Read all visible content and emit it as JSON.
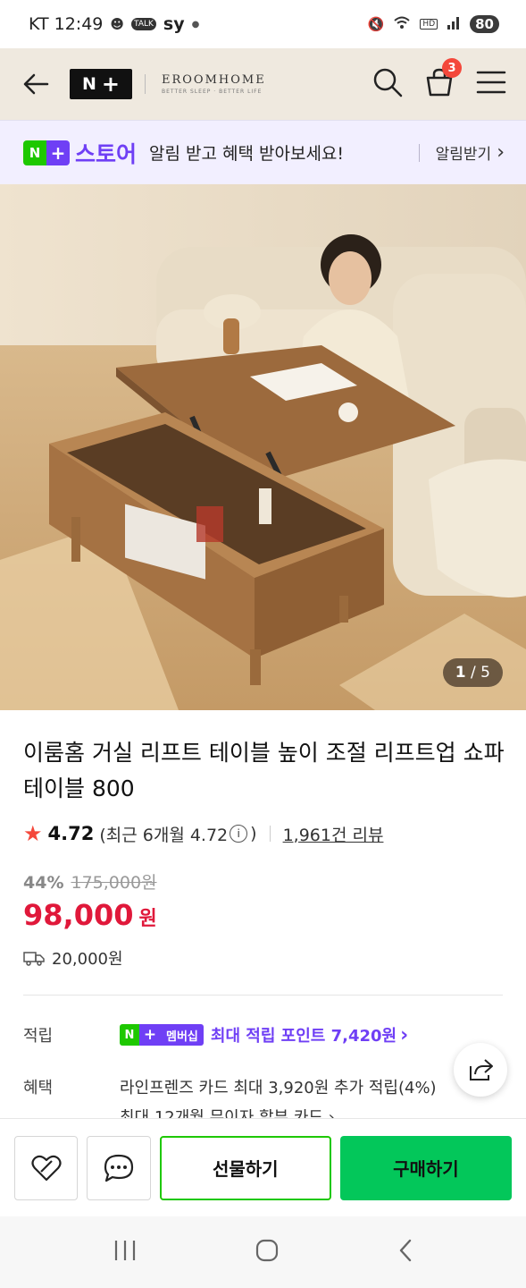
{
  "status_bar": {
    "carrier_time": "KT 12:49",
    "extra": "sy",
    "talk": "TALK",
    "battery": "80"
  },
  "header": {
    "logo_text": "N",
    "brand_name": "EROOMHOME",
    "brand_sub": "BETTER SLEEP · BETTER LIFE",
    "cart_count": "3"
  },
  "store_banner": {
    "logo_n": "N",
    "logo_plus": "+",
    "store_name": "스토어",
    "message": "알림 받고 혜택 받아보세요!",
    "cta": "알림받기",
    "cta_arrow": "›"
  },
  "image": {
    "current": "1",
    "total": "/ 5"
  },
  "product": {
    "title": "이룸홈 거실 리프트 테이블 높이 조절 리프트업 쇼파 테이블 800",
    "rating": "4.72",
    "rating_recent": "(최근 6개월 4.72",
    "rating_close": ")",
    "review_count": "1,961건 리뷰",
    "discount": "44%",
    "original_price": "175,000원",
    "price": "98,000",
    "currency": "원",
    "shipping": "20,000원"
  },
  "benefits": {
    "point_label": "적립",
    "membership_badge": "멤버십",
    "point_text": "최대 적립 포인트 7,420원",
    "point_arrow": "›",
    "benefit_label": "혜택",
    "benefit_text": "라인프렌즈 카드 최대 3,920원 추가 적립(4%)",
    "benefit_text2": "최대 12개월 무이자 할부 카드 ›"
  },
  "actions": {
    "gift": "선물하기",
    "buy": "구매하기"
  },
  "colors": {
    "naver_green": "#03c75a",
    "store_purple": "#6f3ff5",
    "price_red": "#e0183a",
    "header_bg": "#efe9df"
  }
}
